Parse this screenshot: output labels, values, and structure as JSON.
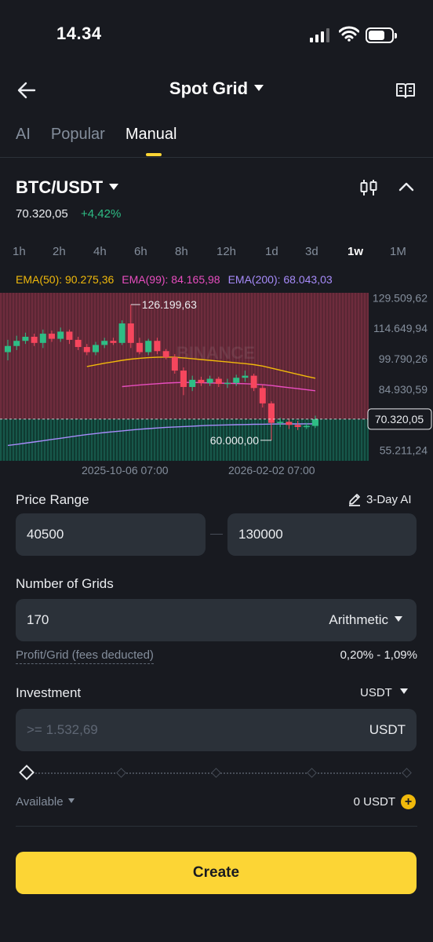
{
  "status": {
    "time": "14.34"
  },
  "header": {
    "title": "Spot Grid"
  },
  "tabs": [
    {
      "label": "AI"
    },
    {
      "label": "Popular"
    },
    {
      "label": "Manual",
      "active": true
    }
  ],
  "pair": {
    "symbol": "BTC/USDT",
    "price": "70.320,05",
    "change": "+4,42%"
  },
  "intervals": [
    "1h",
    "2h",
    "4h",
    "6h",
    "8h",
    "12h",
    "1d",
    "3d",
    "1w",
    "1M"
  ],
  "active_interval": "1w",
  "chart": {
    "ema50": "EMA(50): 90.275,36",
    "ema99": "EMA(99): 84.165,98",
    "ema200": "EMA(200): 68.043,03",
    "y_labels": [
      "129.509,62",
      "114.649,94",
      "99.790,26",
      "84.930,59",
      "55.211,24"
    ],
    "current_price": "70.320,05",
    "high_label": "126.199,63",
    "low_label": "60.000,00",
    "dates": [
      "2025-10-06 07:00",
      "2026-02-02 07:00"
    ],
    "watermark": "BINANCE",
    "colors": {
      "up": "#2EBD85",
      "down": "#F6465D",
      "ema50": "#F0B90B",
      "ema99": "#E84DBF",
      "ema200": "#A78BFA"
    }
  },
  "chart_data": {
    "type": "candlestick",
    "interval": "1w",
    "ylim": [
      50000,
      135000
    ],
    "y_ticks": [
      129509.62,
      114649.94,
      99790.26,
      84930.59,
      55211.24
    ],
    "x_labels": [
      "2025-10-06 07:00",
      "2026-02-02 07:00"
    ],
    "candles": [
      {
        "o": 103000,
        "c": 106000,
        "h": 109000,
        "l": 99000
      },
      {
        "o": 106000,
        "c": 108500,
        "h": 111000,
        "l": 104000
      },
      {
        "o": 108500,
        "c": 110500,
        "h": 112500,
        "l": 107000
      },
      {
        "o": 110500,
        "c": 107500,
        "h": 112000,
        "l": 106000
      },
      {
        "o": 107500,
        "c": 112000,
        "h": 114000,
        "l": 105000
      },
      {
        "o": 112000,
        "c": 109500,
        "h": 113500,
        "l": 108000
      },
      {
        "o": 109500,
        "c": 113000,
        "h": 115000,
        "l": 108000
      },
      {
        "o": 113000,
        "c": 109000,
        "h": 114000,
        "l": 107000
      },
      {
        "o": 109000,
        "c": 105500,
        "h": 110500,
        "l": 104000
      },
      {
        "o": 105500,
        "c": 103000,
        "h": 107000,
        "l": 101500
      },
      {
        "o": 103000,
        "c": 106500,
        "h": 108000,
        "l": 101500
      },
      {
        "o": 106500,
        "c": 108500,
        "h": 110000,
        "l": 105000
      },
      {
        "o": 108500,
        "c": 107500,
        "h": 110000,
        "l": 106500
      },
      {
        "o": 107500,
        "c": 117000,
        "h": 118500,
        "l": 106500
      },
      {
        "o": 117000,
        "c": 107500,
        "h": 126199.63,
        "l": 105000
      },
      {
        "o": 107500,
        "c": 103000,
        "h": 110000,
        "l": 102000
      },
      {
        "o": 103000,
        "c": 108500,
        "h": 109500,
        "l": 101500
      },
      {
        "o": 108500,
        "c": 103500,
        "h": 110000,
        "l": 102000
      },
      {
        "o": 103500,
        "c": 100500,
        "h": 104500,
        "l": 99500
      },
      {
        "o": 100500,
        "c": 94000,
        "h": 102000,
        "l": 92500
      },
      {
        "o": 94000,
        "c": 86000,
        "h": 95500,
        "l": 82000
      },
      {
        "o": 86000,
        "c": 89500,
        "h": 91500,
        "l": 84000
      },
      {
        "o": 89500,
        "c": 88000,
        "h": 91000,
        "l": 86500
      },
      {
        "o": 88000,
        "c": 90000,
        "h": 91500,
        "l": 86500
      },
      {
        "o": 90000,
        "c": 87500,
        "h": 91000,
        "l": 86000
      },
      {
        "o": 87500,
        "c": 88000,
        "h": 90000,
        "l": 85500
      },
      {
        "o": 88000,
        "c": 90500,
        "h": 92000,
        "l": 86500
      },
      {
        "o": 90500,
        "c": 91500,
        "h": 94000,
        "l": 88500
      },
      {
        "o": 91500,
        "c": 85500,
        "h": 92500,
        "l": 84000
      },
      {
        "o": 85500,
        "c": 78000,
        "h": 87000,
        "l": 76000
      },
      {
        "o": 78000,
        "c": 68500,
        "h": 79000,
        "l": 60000
      },
      {
        "o": 68500,
        "c": 69000,
        "h": 71000,
        "l": 66500
      },
      {
        "o": 69000,
        "c": 67500,
        "h": 70500,
        "l": 65500
      },
      {
        "o": 67500,
        "c": 66500,
        "h": 69500,
        "l": 65000
      },
      {
        "o": 66500,
        "c": 67000,
        "h": 68500,
        "l": 65500
      },
      {
        "o": 67000,
        "c": 70320.05,
        "h": 72000,
        "l": 66000
      }
    ],
    "ema50": [
      null,
      null,
      null,
      null,
      null,
      null,
      null,
      null,
      null,
      96000,
      96800,
      97600,
      98300,
      99000,
      99600,
      100000,
      100300,
      100500,
      100600,
      100500,
      100200,
      99800,
      99400,
      99000,
      98600,
      98200,
      97800,
      97400,
      96900,
      96200,
      95200,
      94200,
      93200,
      92200,
      91200,
      90275.36
    ],
    "ema99": [
      null,
      null,
      null,
      null,
      null,
      null,
      null,
      null,
      null,
      null,
      null,
      null,
      null,
      86200,
      86600,
      87000,
      87300,
      87600,
      87900,
      88100,
      88200,
      88200,
      88100,
      88000,
      87900,
      87800,
      87700,
      87600,
      87400,
      87100,
      86700,
      86200,
      85700,
      85200,
      84700,
      84165.98
    ],
    "ema200": [
      57500,
      58000,
      58600,
      59200,
      59800,
      60400,
      61000,
      61600,
      62200,
      62800,
      63300,
      63800,
      64200,
      64600,
      65000,
      65400,
      65700,
      66000,
      66300,
      66500,
      66700,
      66900,
      67100,
      67300,
      67400,
      67500,
      67600,
      67700,
      67800,
      67850,
      67900,
      67950,
      67980,
      68000,
      68020,
      68043.03
    ],
    "price_range": [
      40500,
      130000
    ],
    "annotations": [
      {
        "text": "126.199,63",
        "value": 126199.63
      },
      {
        "text": "60.000,00",
        "value": 60000
      },
      {
        "text": "70.320,05",
        "value": 70320.05
      }
    ]
  },
  "form": {
    "price_range_label": "Price Range",
    "ai_label": "3-Day AI",
    "price_low": "40500",
    "price_high": "130000",
    "grids_label": "Number of Grids",
    "grids_value": "170",
    "grid_mode": "Arithmetic",
    "profit_label": "Profit/Grid (fees deducted)",
    "profit_value": "0,20% - 1,09%",
    "investment_label": "Investment",
    "investment_currency": "USDT",
    "investment_placeholder": ">= 1.532,69",
    "investment_unit": "USDT",
    "slider_percent": 0,
    "available_label": "Available",
    "available_value": "0 USDT",
    "create_label": "Create"
  }
}
